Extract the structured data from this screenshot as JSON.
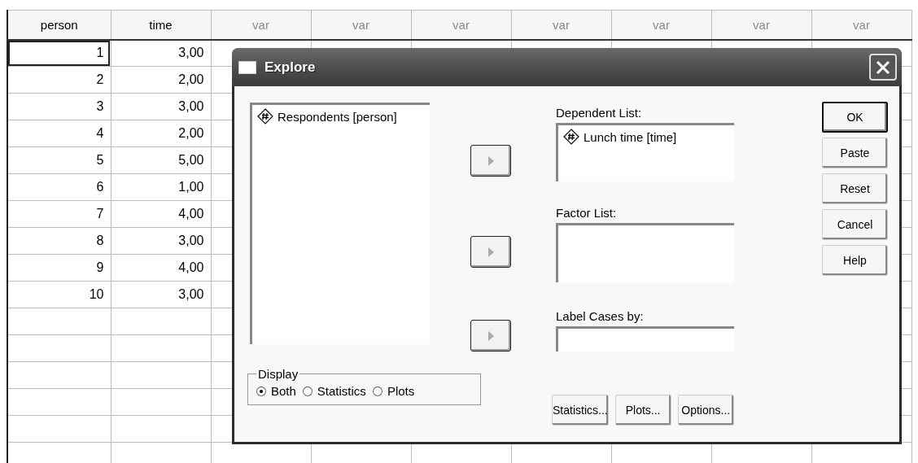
{
  "grid": {
    "columns": [
      {
        "label": "person",
        "kind": "defined"
      },
      {
        "label": "time",
        "kind": "defined"
      },
      {
        "label": "var",
        "kind": "empty"
      },
      {
        "label": "var",
        "kind": "empty"
      },
      {
        "label": "var",
        "kind": "empty"
      },
      {
        "label": "var",
        "kind": "empty"
      },
      {
        "label": "var",
        "kind": "empty"
      },
      {
        "label": "var",
        "kind": "empty"
      },
      {
        "label": "var",
        "kind": "empty"
      }
    ],
    "rows": [
      {
        "cells": [
          "1",
          "3,00"
        ],
        "active": true
      },
      {
        "cells": [
          "2",
          "2,00"
        ],
        "active": false
      },
      {
        "cells": [
          "3",
          "3,00"
        ],
        "active": false
      },
      {
        "cells": [
          "4",
          "2,00"
        ],
        "active": false
      },
      {
        "cells": [
          "5",
          "5,00"
        ],
        "active": false
      },
      {
        "cells": [
          "6",
          "1,00"
        ],
        "active": false
      },
      {
        "cells": [
          "7",
          "4,00"
        ],
        "active": false
      },
      {
        "cells": [
          "8",
          "3,00"
        ],
        "active": false
      },
      {
        "cells": [
          "9",
          "4,00"
        ],
        "active": false
      },
      {
        "cells": [
          "10",
          "3,00"
        ],
        "active": false
      }
    ]
  },
  "dialog": {
    "title": "Explore",
    "source_list": {
      "items": [
        {
          "label": "Respondents [person]"
        }
      ]
    },
    "arrow_buttons": [
      {
        "disabled": true
      },
      {
        "disabled": true
      },
      {
        "disabled": true
      }
    ],
    "dependent_list": {
      "label": "Dependent List:",
      "items": [
        {
          "label": "Lunch time [time]"
        }
      ]
    },
    "factor_list": {
      "label": "Factor List:"
    },
    "label_cases": {
      "label": "Label Cases by:"
    },
    "action_buttons": [
      {
        "label": "OK",
        "default": true
      },
      {
        "label": "Paste",
        "default": false
      },
      {
        "label": "Reset",
        "default": false
      },
      {
        "label": "Cancel",
        "default": false
      },
      {
        "label": "Help",
        "default": false
      }
    ],
    "display": {
      "label": "Display",
      "options": [
        {
          "label": "Both",
          "selected": true
        },
        {
          "label": "Statistics",
          "selected": false
        },
        {
          "label": "Plots",
          "selected": false
        }
      ]
    },
    "bottom_buttons": [
      {
        "label": "Statistics..."
      },
      {
        "label": "Plots..."
      },
      {
        "label": "Options..."
      }
    ]
  }
}
